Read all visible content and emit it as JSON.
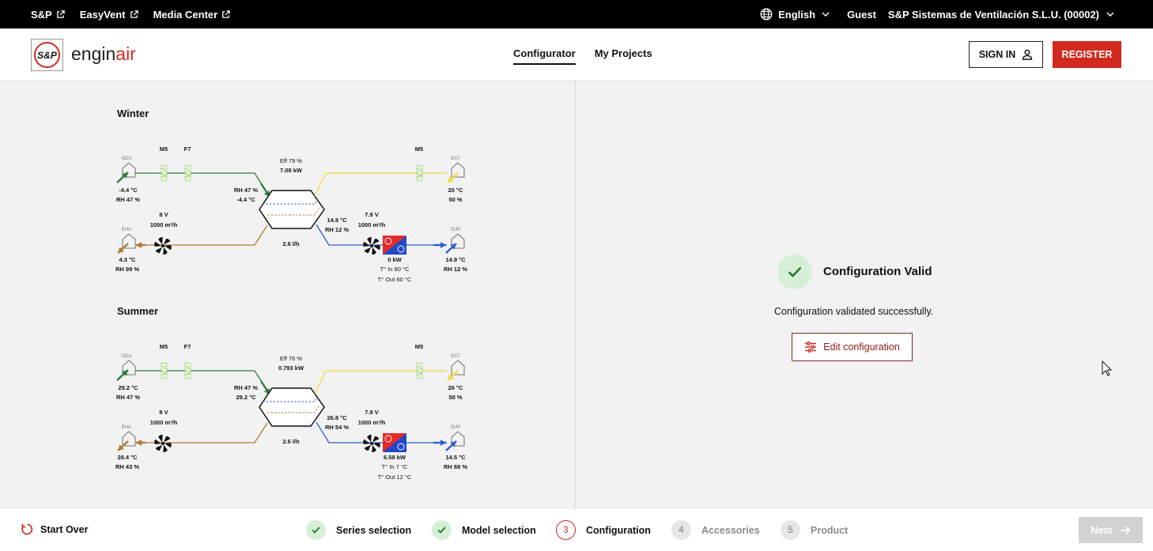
{
  "topbar": {
    "links": [
      "S&P",
      "EasyVent",
      "Media Center"
    ],
    "language": "English",
    "guest": "Guest",
    "company": "S&P Sistemas de Ventilación S.L.U. (00002)"
  },
  "header": {
    "logo_text": "S&P",
    "brand_prefix": "engin",
    "brand_suffix": "air",
    "nav": [
      "Configurator",
      "My Projects"
    ],
    "active_nav": "Configurator",
    "signin_label": "SIGN IN",
    "register_label": "REGISTER"
  },
  "diagrams": [
    {
      "title": "Winter",
      "filters_left": [
        "M5",
        "F7"
      ],
      "filter_right": "M5",
      "oda": {
        "label": "ODA",
        "temp": "-4.4 °C",
        "rh": "RH 47 %"
      },
      "ext": {
        "label": "EXT",
        "temp": "20 °C",
        "rh": "50 %"
      },
      "eha": {
        "label": "EHA",
        "temp": "4.3 °C",
        "rh": "RH 99 %"
      },
      "sup": {
        "label": "SUP",
        "temp": "14.9 °C",
        "rh": "RH 12 %"
      },
      "eff": "Eff 79 %",
      "power": "7.08 kW",
      "hx_in_rh": "RH 47 %",
      "hx_in_temp": "-4.4 °C",
      "hx_out_temp": "14.9 °C",
      "hx_out_rh": "RH 12 %",
      "fan_left_v": "8 V",
      "fan_left_flow": "1000 m³/h",
      "fan_right_v": "7.9 V",
      "fan_right_flow": "1000 m³/h",
      "condensate": "2.6 l/h",
      "coil_kw": "0 kW",
      "t_in": "T° In 80 °C",
      "t_out": "T° Out 60 °C"
    },
    {
      "title": "Summer",
      "filters_left": [
        "M5",
        "F7"
      ],
      "filter_right": "M5",
      "oda": {
        "label": "ODA",
        "temp": "29.2 °C",
        "rh": "RH 47 %"
      },
      "ext": {
        "label": "EXT",
        "temp": "26 °C",
        "rh": "50 %"
      },
      "eha": {
        "label": "EHA",
        "temp": "28.4 °C",
        "rh": "RH 43 %"
      },
      "sup": {
        "label": "SUP",
        "temp": "14.5 °C",
        "rh": "RH 88 %"
      },
      "eff": "Eff 76 %",
      "power": "0.793 kW",
      "hx_in_rh": "RH 47 %",
      "hx_in_temp": "29.2 °C",
      "hx_out_temp": "26.8 °C",
      "hx_out_rh": "RH 54 %",
      "fan_left_v": "8 V",
      "fan_left_flow": "1000 m³/h",
      "fan_right_v": "7.9 V",
      "fan_right_flow": "1000 m³/h",
      "condensate": "2.6 l/h",
      "coil_kw": "6.58 kW",
      "t_in": "T° In 7 °C",
      "t_out": "T° Out 12 °C"
    }
  ],
  "validation": {
    "title": "Configuration Valid",
    "message": "Configuration validated successfully.",
    "edit_label": "Edit configuration"
  },
  "footer": {
    "start_over": "Start Over",
    "steps": [
      {
        "num": "1",
        "label": "Series selection",
        "state": "done"
      },
      {
        "num": "2",
        "label": "Model selection",
        "state": "done"
      },
      {
        "num": "3",
        "label": "Configuration",
        "state": "current"
      },
      {
        "num": "4",
        "label": "Accessories",
        "state": "todo"
      },
      {
        "num": "5",
        "label": "Product",
        "state": "todo"
      }
    ],
    "next_label": "Next"
  },
  "colors": {
    "brand_red": "#d32a20",
    "oda_green": "#2e7d3e",
    "ext_yellow": "#f3d83c",
    "eha_brown": "#b07a2c",
    "sup_blue": "#2f5fd0",
    "valid_green_bg": "#d7efd7"
  }
}
